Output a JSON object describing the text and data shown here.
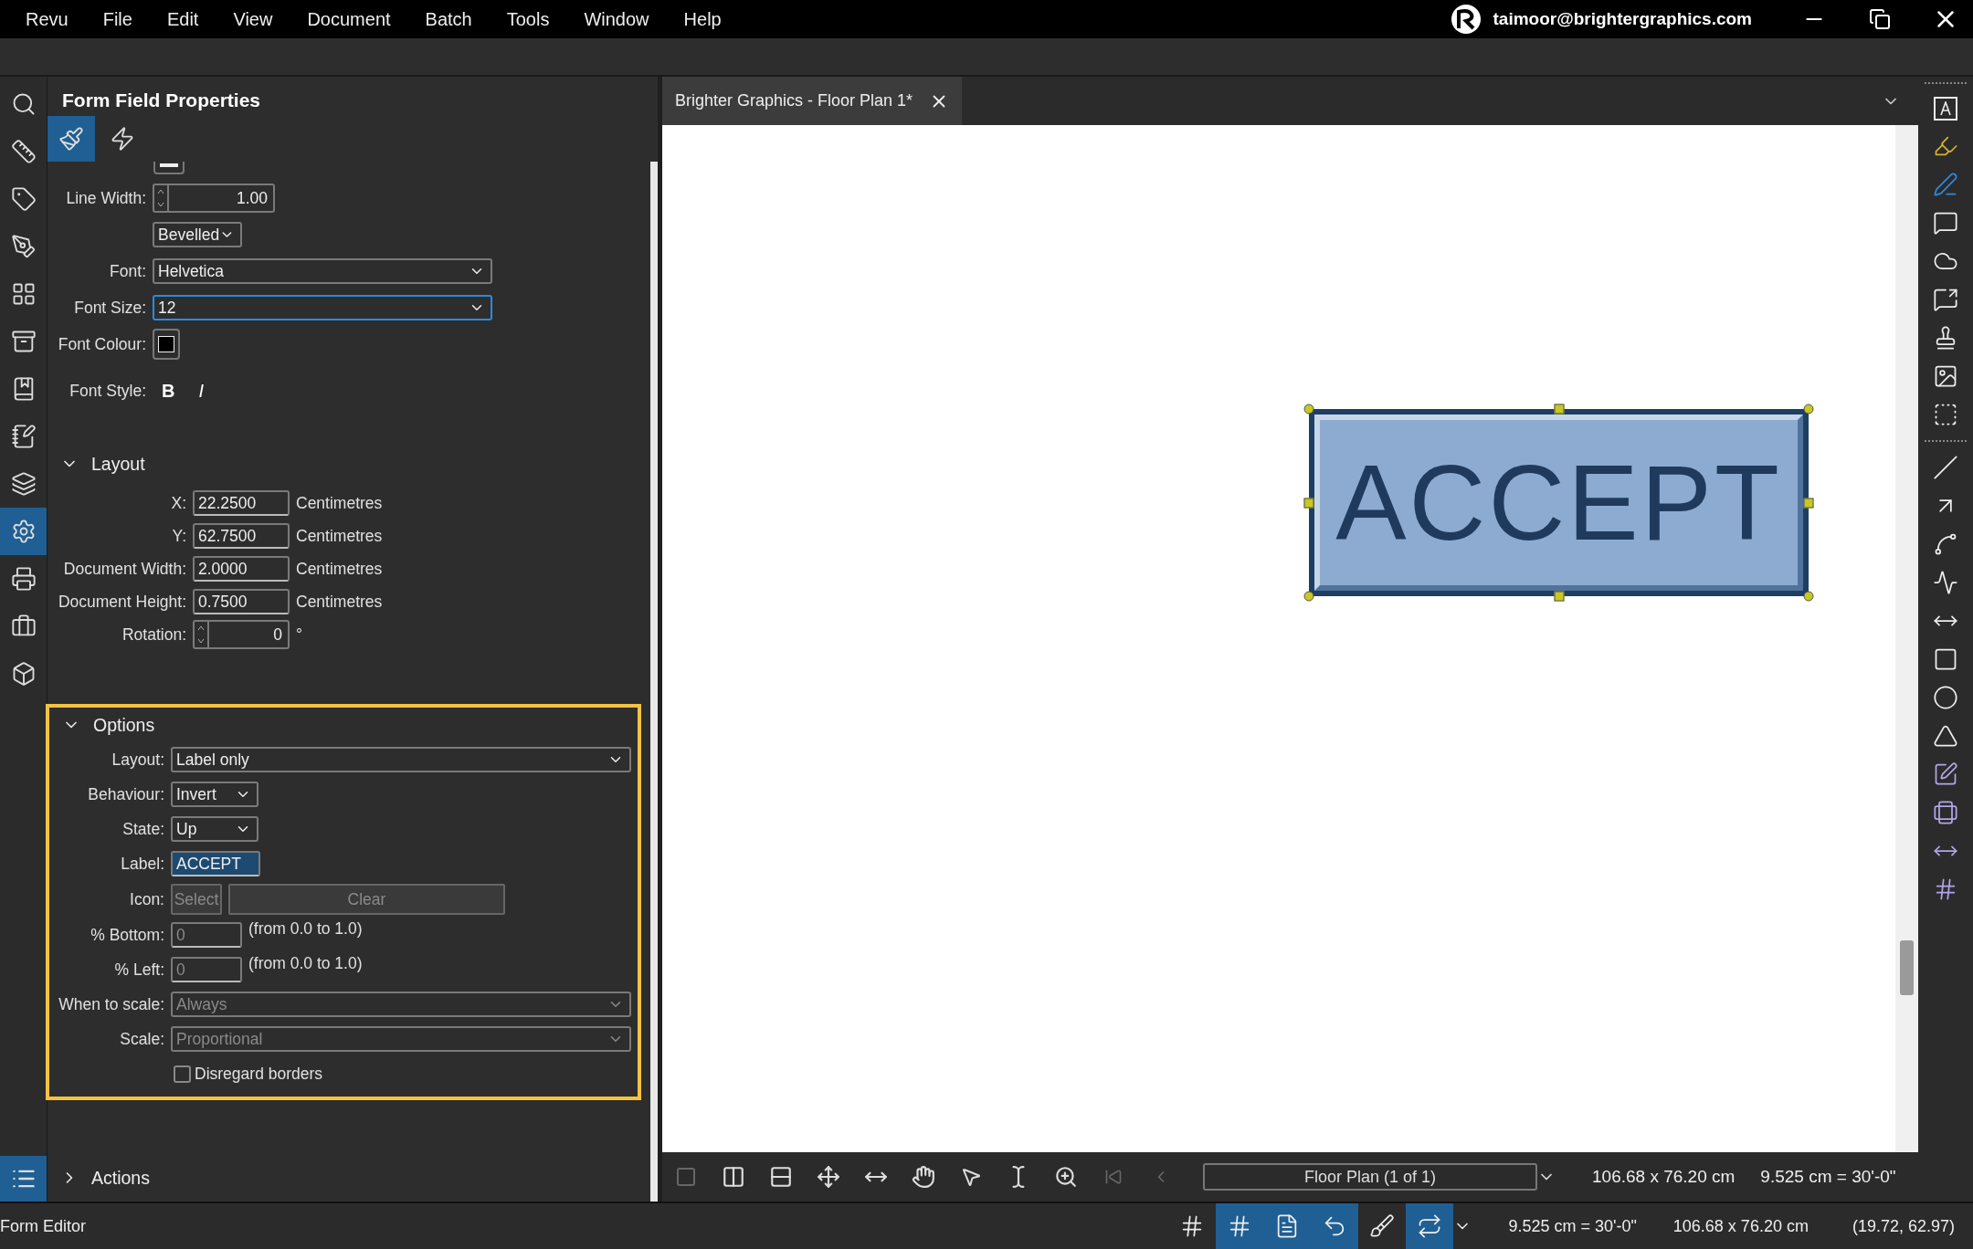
{
  "menu": [
    "Revu",
    "File",
    "Edit",
    "View",
    "Document",
    "Batch",
    "Tools",
    "Window",
    "Help"
  ],
  "account": {
    "email": "taimoor@brightergraphics.com"
  },
  "left_rail": [
    {
      "kind": "search",
      "selected": false
    },
    {
      "kind": "ruler",
      "selected": false
    },
    {
      "kind": "tag",
      "selected": false
    },
    {
      "kind": "signature",
      "selected": false
    },
    {
      "kind": "grid",
      "selected": false
    },
    {
      "kind": "cabinet",
      "selected": false
    },
    {
      "kind": "bookmark",
      "selected": false
    },
    {
      "kind": "notes",
      "selected": false
    },
    {
      "kind": "layers",
      "selected": false
    },
    {
      "kind": "settings",
      "selected": true
    },
    {
      "kind": "printer",
      "selected": false
    },
    {
      "kind": "toolbox",
      "selected": false
    },
    {
      "kind": "model",
      "selected": false
    }
  ],
  "rail_bottom": {
    "kind": "list",
    "selected": true
  },
  "panel": {
    "title": "Form Field Properties",
    "tabs": [
      {
        "kind": "appearance",
        "selected": true
      },
      {
        "kind": "actions",
        "selected": false
      }
    ],
    "appearance": [
      {
        "kind": "spinner",
        "label": "Line Width:",
        "value": "1.00"
      },
      {
        "kind": "select",
        "value": "Bevelled",
        "focused": false
      },
      {
        "kind": "select",
        "label": "Font:",
        "value": "Helvetica",
        "focused": false
      },
      {
        "kind": "select",
        "label": "Font Size:",
        "value": "12",
        "focused": true
      },
      {
        "kind": "colour",
        "label": "Font Colour:",
        "color": "#000000"
      },
      {
        "kind": "style",
        "label": "Font Style:",
        "bold": "B",
        "italic": "I"
      }
    ],
    "layout": {
      "title": "Layout",
      "expanded": true,
      "fields": [
        {
          "kind": "input",
          "label": "X:",
          "value": "22.2500",
          "unit": "Centimetres"
        },
        {
          "kind": "input",
          "label": "Y:",
          "value": "62.7500",
          "unit": "Centimetres"
        },
        {
          "kind": "input",
          "label": "Document Width:",
          "value": "2.0000",
          "unit": "Centimetres"
        },
        {
          "kind": "input",
          "label": "Document Height:",
          "value": "0.7500",
          "unit": "Centimetres"
        },
        {
          "kind": "spinner",
          "label": "Rotation:",
          "value": "0",
          "unit": "°"
        }
      ]
    },
    "options": {
      "title": "Options",
      "expanded": true,
      "highlighted": true,
      "rows": [
        {
          "kind": "select",
          "label": "Layout:",
          "value": "Label only",
          "disabled": false
        },
        {
          "kind": "select",
          "label": "Behaviour:",
          "value": "Invert",
          "disabled": false
        },
        {
          "kind": "select",
          "label": "State:",
          "value": "Up",
          "disabled": false
        },
        {
          "kind": "text",
          "label": "Label:",
          "value": "ACCEPT",
          "focused": true
        },
        {
          "kind": "buttons",
          "label": "Icon:",
          "buttons": [
            "Select",
            "Clear"
          ],
          "disabled": true
        },
        {
          "kind": "range",
          "label": "% Bottom:",
          "value": "0",
          "hint": "(from 0.0 to 1.0)",
          "disabled": true
        },
        {
          "kind": "range",
          "label": "% Left:",
          "value": "0",
          "hint": "(from 0.0 to 1.0)",
          "disabled": true
        },
        {
          "kind": "select",
          "label": "When to scale:",
          "value": "Always",
          "disabled": true
        },
        {
          "kind": "select",
          "label": "Scale:",
          "value": "Proportional",
          "disabled": true
        },
        {
          "kind": "checkbox",
          "label": "Disregard borders",
          "checked": false
        }
      ]
    },
    "actions": {
      "title": "Actions",
      "expanded": false
    }
  },
  "document_tab": {
    "title": "Brighter Graphics - Floor Plan 1*"
  },
  "canvas": {
    "field": {
      "label": "ACCEPT",
      "selected": true
    }
  },
  "doc_toolbar": {
    "page": "Floor Plan (1 of 1)",
    "size": "106.68 x 76.20 cm",
    "scale": "9.525 cm = 30'-0\""
  },
  "status_bar": {
    "mode": "Form Editor",
    "toggles": [
      {
        "kind": "grid",
        "selected": false
      },
      {
        "kind": "snap-grid",
        "selected": true
      },
      {
        "kind": "snap-content",
        "selected": true
      },
      {
        "kind": "snap-markup",
        "selected": true
      },
      {
        "kind": "reuse",
        "selected": false
      },
      {
        "kind": "sync",
        "selected": true
      }
    ],
    "scale": "9.525 cm = 30'-0\"",
    "size": "106.68 x 76.20 cm",
    "coords": "(19.72, 62.97)"
  }
}
